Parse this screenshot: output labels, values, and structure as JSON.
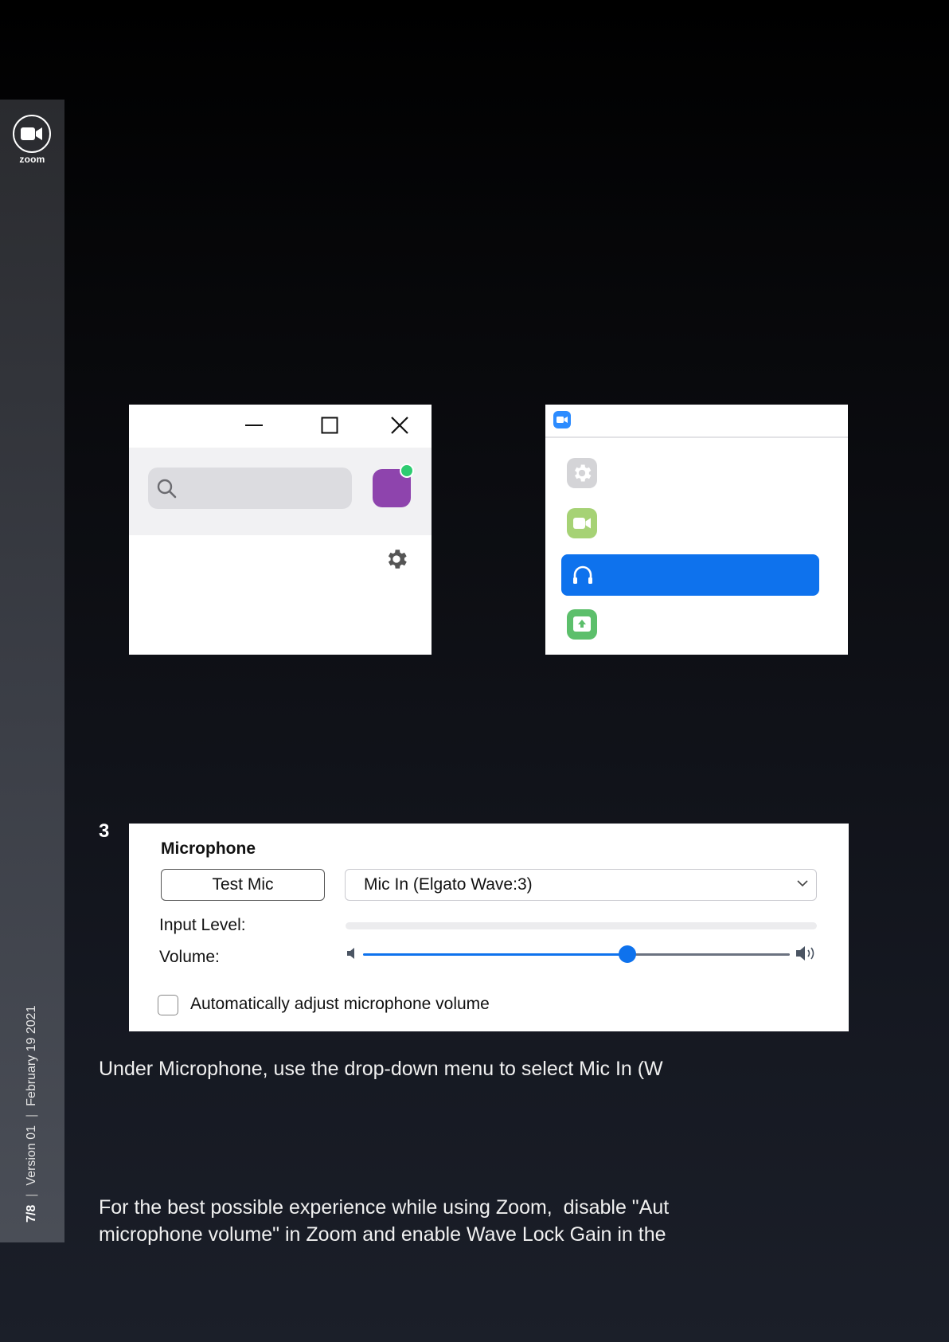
{
  "sidebar": {
    "brand_word": "zoom",
    "page": "7/8",
    "version": "Version 01",
    "date": "February 19 2021",
    "separator": "|"
  },
  "panel_window": {
    "icons": [
      "minimize-icon",
      "maximize-icon",
      "close-icon",
      "search-icon",
      "avatar",
      "gear-icon"
    ],
    "avatar_color": "#8e44ad",
    "presence_color": "#2ecc71"
  },
  "panel_settings_nav": {
    "icons": [
      "zoom-app-icon",
      "settings-gear-icon",
      "video-icon",
      "headphones-icon",
      "share-screen-icon"
    ],
    "selected_color": "#0e72ed"
  },
  "step": {
    "number": "3"
  },
  "microphone": {
    "title": "Microphone",
    "test_button": "Test Mic",
    "device": "Mic In (Elgato Wave:3)",
    "input_level_label": "Input Level:",
    "input_level": 0,
    "volume_label": "Volume:",
    "volume_fraction": 0.62,
    "auto_adjust_label": "Automatically adjust microphone volume",
    "auto_adjust_checked": false
  },
  "text": {
    "line1": "Under Microphone, use the drop-down menu to select Mic In (W",
    "line2": "For the best possible experience while using Zoom,  disable \"Aut",
    "line3": "microphone volume\" in Zoom and enable Wave Lock Gain in the"
  },
  "colors": {
    "accent": "#0e72ed",
    "slider_rest": "#6b7280"
  }
}
